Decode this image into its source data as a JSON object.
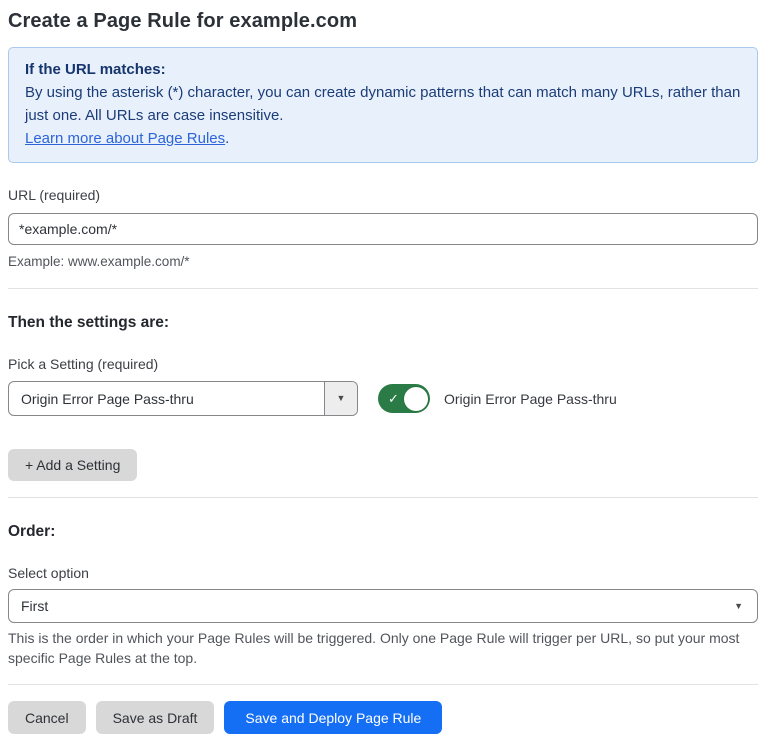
{
  "page": {
    "title": "Create a Page Rule for example.com"
  },
  "info_box": {
    "heading": "If the URL matches:",
    "body": "By using the asterisk (*) character, you can create dynamic patterns that can match many URLs, rather than just one. All URLs are case insensitive.",
    "link_label": "Learn more about Page Rules",
    "link_suffix": "."
  },
  "url_field": {
    "label": "URL (required)",
    "value": "*example.com/*",
    "example": "Example: www.example.com/*"
  },
  "settings": {
    "heading": "Then the settings are:",
    "pick_label": "Pick a Setting (required)",
    "selected_setting": "Origin Error Page Pass-thru",
    "toggle_state": "on",
    "toggle_label": "Origin Error Page Pass-thru",
    "add_button_label": "+ Add a Setting"
  },
  "order": {
    "heading": "Order:",
    "label": "Select option",
    "selected_option": "First",
    "help": "This is the order in which your Page Rules will be triggered. Only one Page Rule will trigger per URL, so put your most specific Page Rules at the top."
  },
  "footer": {
    "cancel_label": "Cancel",
    "save_draft_label": "Save as Draft",
    "save_deploy_label": "Save and Deploy Page Rule"
  },
  "icons": {
    "dropdown_arrow": "▼",
    "toggle_check": "✓"
  },
  "colors": {
    "info_bg": "#e8f1fb",
    "info_border": "#abc9ec",
    "info_text": "#1b3c78",
    "link": "#2d64d8",
    "toggle_on": "#2a7b45",
    "primary_button": "#156ff5",
    "secondary_button": "#d8d8d8"
  }
}
